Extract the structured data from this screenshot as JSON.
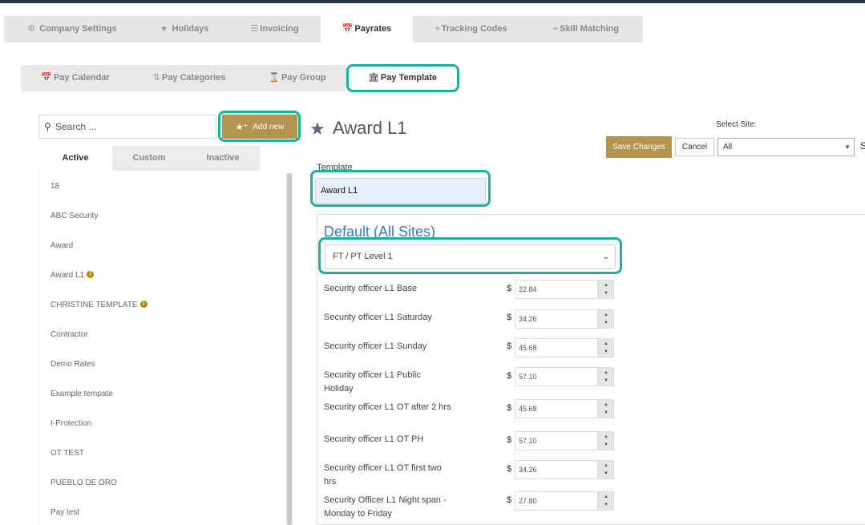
{
  "main_tabs": [
    {
      "icon": "gear-icon",
      "glyph": "⚙",
      "label": "Company Settings"
    },
    {
      "icon": "star-icon",
      "glyph": "★",
      "label": "Holidays"
    },
    {
      "icon": "invoice-icon",
      "glyph": "☰",
      "label": "Invoicing"
    },
    {
      "icon": "calendar-icon",
      "glyph": "📅",
      "label": "Payrates"
    },
    {
      "icon": "crosshair-icon",
      "glyph": "⌖",
      "label": "Tracking Codes"
    },
    {
      "icon": "crosshair-icon",
      "glyph": "⌖",
      "label": "Skill Matching"
    }
  ],
  "sub_tabs": [
    {
      "icon": "calendar-icon",
      "glyph": "📅",
      "label": "Pay Calendar"
    },
    {
      "icon": "sort-icon",
      "glyph": "⇅",
      "label": "Pay Categories"
    },
    {
      "icon": "hourglass-icon",
      "glyph": "⌛",
      "label": "Pay Group"
    },
    {
      "icon": "bank-icon",
      "glyph": "🏛",
      "label": "Pay Template"
    }
  ],
  "sidebar": {
    "search_placeholder": "Search ...",
    "add_new_label": "Add new",
    "tabs": [
      "Active",
      "Custom",
      "Inactive"
    ],
    "items": [
      {
        "label": "18",
        "info": false
      },
      {
        "label": "ABC Security",
        "info": false
      },
      {
        "label": "Award",
        "info": false
      },
      {
        "label": "Award L1",
        "info": true
      },
      {
        "label": "CHRISTINE TEMPLATE",
        "info": true
      },
      {
        "label": "Contractor",
        "info": false
      },
      {
        "label": "Demo Rates",
        "info": false
      },
      {
        "label": "Example tempate",
        "info": false
      },
      {
        "label": "I-Protection",
        "info": false
      },
      {
        "label": "OT TEST",
        "info": false
      },
      {
        "label": "PUEBLO DE ORO",
        "info": false
      },
      {
        "label": "Pay test",
        "info": false
      }
    ]
  },
  "header": {
    "title": "Award L1",
    "select_site_label": "Select Site:",
    "save_label": "Save Changes",
    "cancel_label": "Cancel",
    "site_value": "All",
    "cutoff_text": "S"
  },
  "template": {
    "label": "Template",
    "value": "Award L1"
  },
  "rates": {
    "section_title": "Default (All Sites)",
    "level_value": "FT / PT Level 1",
    "currency": "$",
    "rows": [
      {
        "label": "Security officer L1 Base",
        "value": "22.84"
      },
      {
        "label": "Security officer L1 Saturday",
        "value": "34.26"
      },
      {
        "label": "Security officer L1 Sunday",
        "value": "45.68"
      },
      {
        "label": "Security officer L1 Public Holiday",
        "value": "57.10"
      },
      {
        "label": "Security officer L1 OT after 2 hrs",
        "value": "45.68"
      },
      {
        "label": "Security officer L1 OT PH",
        "value": "57.10"
      },
      {
        "label": "Security officer L1 OT first two hrs",
        "value": "34.26"
      },
      {
        "label": "Security Officer L1 Night span - Monday to Friday",
        "value": "27.80"
      }
    ]
  },
  "colors": {
    "accent_gold": "#b39550",
    "highlight_teal": "#19b39a",
    "title_blue": "#3a7bbf"
  }
}
